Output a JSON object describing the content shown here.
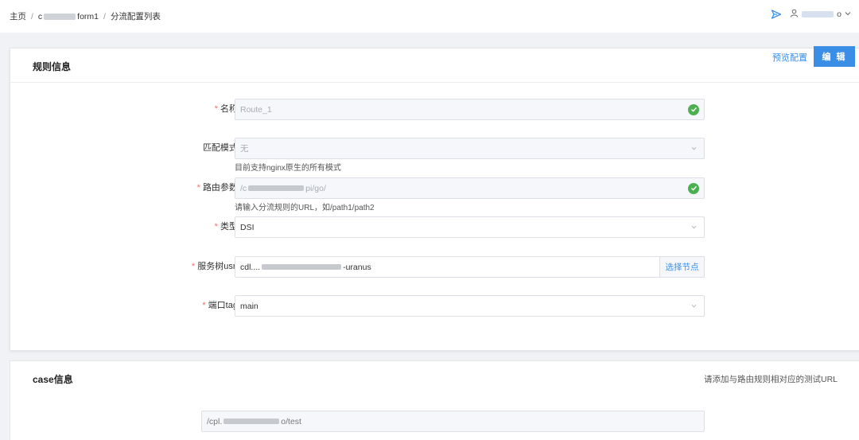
{
  "breadcrumb": {
    "home": "主页",
    "project_start": "c",
    "project_end": "form1",
    "current": "分流配置列表",
    "separator": "/"
  },
  "user": {
    "name_end": "o"
  },
  "card_rules": {
    "title": "规则信息",
    "preview_label": "预览配置",
    "edit_label": "编 辑",
    "fields": {
      "name": {
        "label": "名称:",
        "value": "Route_1"
      },
      "match_mode": {
        "label": "匹配模式:",
        "value": "无",
        "hint": "目前支持nginx原生的所有模式"
      },
      "route_param": {
        "label": "路由参数:",
        "value_start": "/c",
        "value_end": "pi/go/",
        "hint": "请输入分流规则的URL，如/path1/path2"
      },
      "type": {
        "label": "类型:",
        "value": "DSI"
      },
      "service_tree": {
        "label": "服务树usn:",
        "value_start": "cdl....",
        "value_end": "-uranus",
        "button": "选择节点"
      },
      "port_tag": {
        "label": "端口tag:",
        "value": "main"
      }
    }
  },
  "card_case": {
    "title": "case信息",
    "hint": "请添加与路由规则相对应的测试URL",
    "value_start": "/cpl.",
    "value_end": "o/test"
  },
  "colors": {
    "accent": "#3a8ee6",
    "required": "#f56c6c",
    "success": "#4caf50"
  },
  "icons": [
    "send-icon",
    "user-icon",
    "chevron-down-icon",
    "check-circle-icon"
  ]
}
